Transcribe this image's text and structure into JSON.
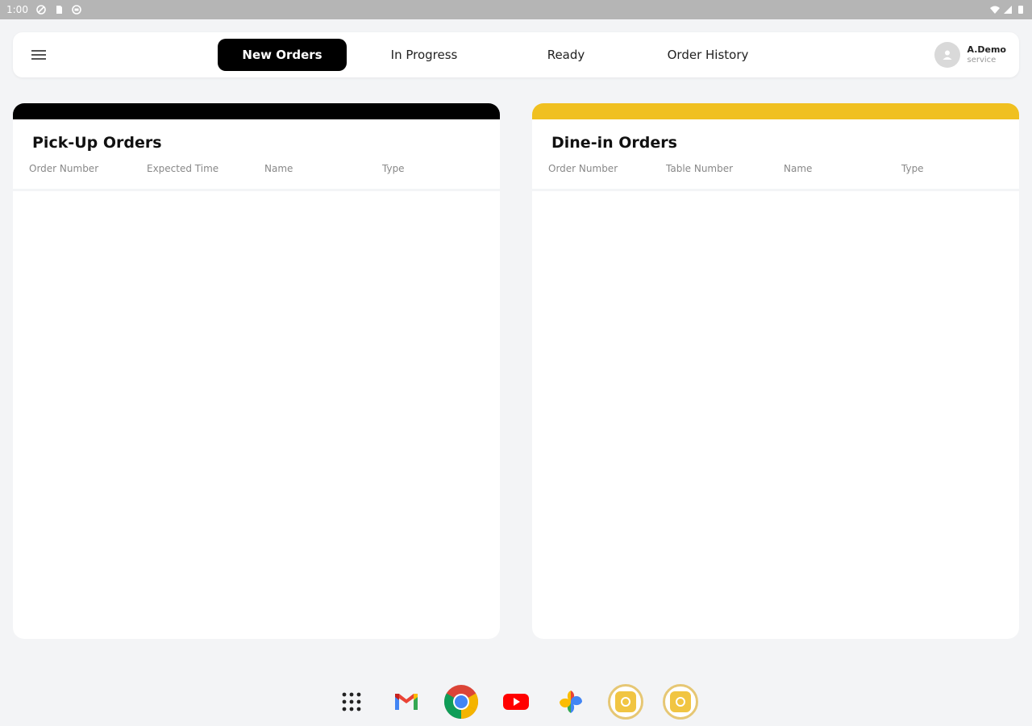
{
  "status_bar": {
    "time": "1:00"
  },
  "header": {
    "tabs": [
      {
        "label": "New Orders",
        "active": true
      },
      {
        "label": "In Progress",
        "active": false
      },
      {
        "label": "Ready",
        "active": false
      },
      {
        "label": "Order History",
        "active": false
      }
    ],
    "user": {
      "name": "A.Demo",
      "role": "service"
    }
  },
  "pickup": {
    "title": "Pick-Up Orders",
    "accent": "#000000",
    "columns": [
      "Order Number",
      "Expected Time",
      "Name",
      "Type"
    ]
  },
  "dinein": {
    "title": "Dine-in Orders",
    "accent": "#f0c020",
    "columns": [
      "Order Number",
      "Table Number",
      "Name",
      "Type"
    ]
  },
  "dock": {
    "apps": [
      "app-drawer-icon",
      "gmail-icon",
      "chrome-icon",
      "youtube-icon",
      "photos-icon",
      "orders-app-icon",
      "orders-app-icon"
    ]
  }
}
